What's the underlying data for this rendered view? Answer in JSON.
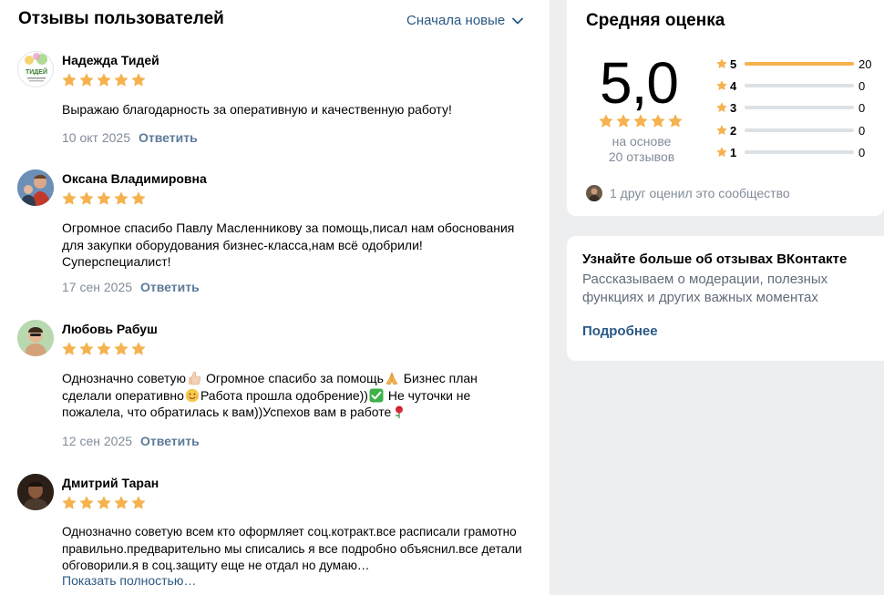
{
  "reviews_header": {
    "title": "Отзывы пользователей",
    "sort_label": "Сначала новые"
  },
  "reviews": [
    {
      "name": "Надежда Тидей",
      "avatar_text": "ТИДЕЙ",
      "rating": 5,
      "text": "Выражаю благодарность за оперативную и качественную работу!",
      "date": "10 окт 2025",
      "reply_label": "Ответить"
    },
    {
      "name": "Оксана Владимировна",
      "rating": 5,
      "text": "Огромное спасибо Павлу Масленникову за помощь,писал нам обоснования для закупки оборудования бизнес-класса,нам всё одобрили! Суперспециалист!",
      "date": "17 сен 2025",
      "reply_label": "Ответить"
    },
    {
      "name": "Любовь Рабуш",
      "rating": 5,
      "text_parts": [
        "Однозначно советую",
        " Огромное спасибо за помощь",
        " Бизнес план сделали оперативно",
        "Работа прошла одобрение))",
        " Не чуточки не пожалела, что обратилась к вам))Успехов вам в работе"
      ],
      "date": "12 сен 2025",
      "reply_label": "Ответить"
    },
    {
      "name": "Дмитрий Таран",
      "rating": 5,
      "text": "Однозначно советую всем кто оформляет соц.котракт.все расписали грамотно правильно.предварительно мы списались я все подробно объяснил.все детали обговорили.я в соц.защиту еще не отдал но думаю…",
      "show_more_label": "Показать полностью…"
    }
  ],
  "rating_card": {
    "title": "Средняя оценка",
    "average": "5,0",
    "based_on": "на основе",
    "reviews_count": "20 отзывов",
    "distribution": [
      {
        "stars": "5",
        "count": "20",
        "fraction": 1.0
      },
      {
        "stars": "4",
        "count": "0",
        "fraction": 0
      },
      {
        "stars": "3",
        "count": "0",
        "fraction": 0
      },
      {
        "stars": "2",
        "count": "0",
        "fraction": 0
      },
      {
        "stars": "1",
        "count": "0",
        "fraction": 0
      }
    ],
    "friends_text": "1 друг оценил это сообщество"
  },
  "info_card": {
    "title": "Узнайте больше об отзывах ВКонтакте",
    "text": "Рассказываем о модерации, полезных функциях и других важных моментах",
    "link_label": "Подробнее"
  },
  "colors": {
    "star": "#f5b24e",
    "link": "#2a5885",
    "muted": "#818c99",
    "bar_bg": "#dce1e6"
  }
}
